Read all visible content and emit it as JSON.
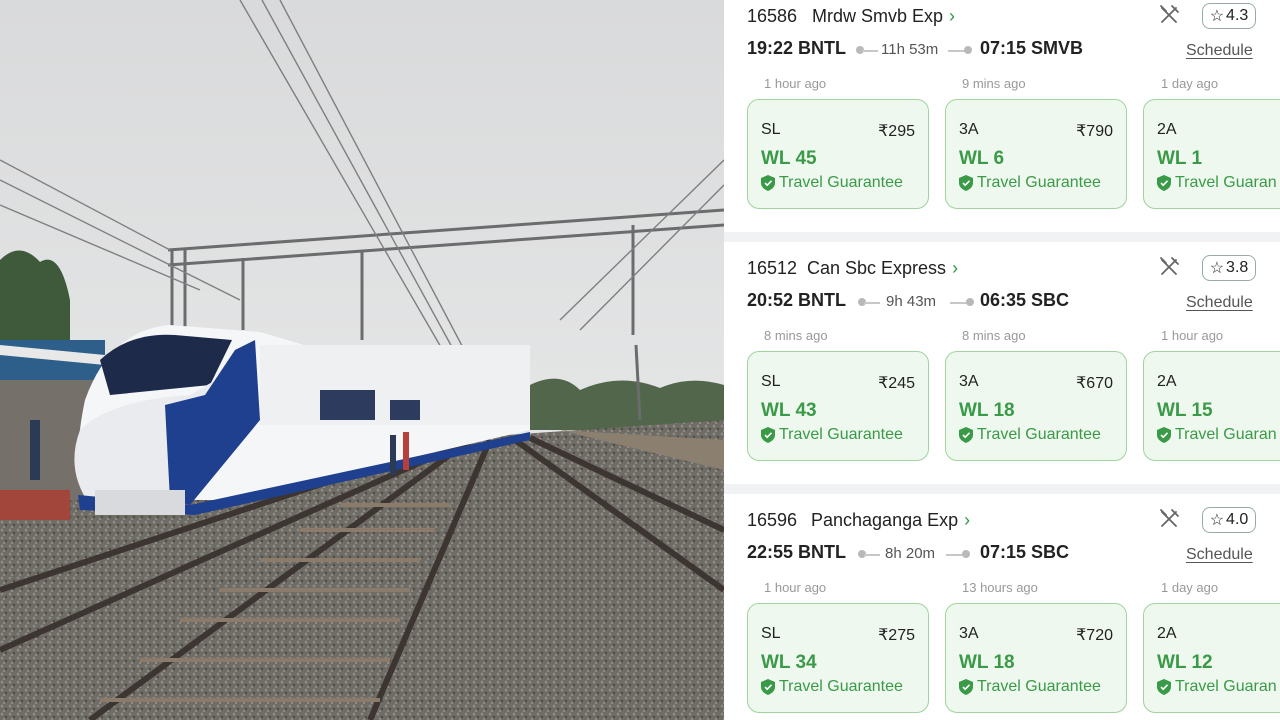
{
  "trains": [
    {
      "number": "16586",
      "name": "Mrdw Smvb Exp",
      "rating": "4.3",
      "departure": "19:22 BNTL",
      "duration": "11h 53m",
      "arrival": "07:15 SMVB",
      "schedule_label": "Schedule",
      "classes": [
        {
          "updated": "1 hour ago",
          "class": "SL",
          "fare": "₹295",
          "status": "WL 45",
          "guarantee": "Travel Guarantee"
        },
        {
          "updated": "9 mins ago",
          "class": "3A",
          "fare": "₹790",
          "status": "WL 6",
          "guarantee": "Travel Guarantee"
        },
        {
          "updated": "1 day ago",
          "class": "2A",
          "fare": "₹",
          "status": "WL 1",
          "guarantee": "Travel Guaran"
        }
      ]
    },
    {
      "number": "16512",
      "name": "Can Sbc Express",
      "rating": "3.8",
      "departure": "20:52 BNTL",
      "duration": "9h 43m",
      "arrival": "06:35 SBC",
      "schedule_label": "Schedule",
      "classes": [
        {
          "updated": "8 mins ago",
          "class": "SL",
          "fare": "₹245",
          "status": "WL 43",
          "guarantee": "Travel Guarantee"
        },
        {
          "updated": "8 mins ago",
          "class": "3A",
          "fare": "₹670",
          "status": "WL 18",
          "guarantee": "Travel Guarantee"
        },
        {
          "updated": "1 hour ago",
          "class": "2A",
          "fare": "₹",
          "status": "WL 15",
          "guarantee": "Travel Guaran"
        }
      ]
    },
    {
      "number": "16596",
      "name": "Panchaganga Exp",
      "rating": "4.0",
      "departure": "22:55 BNTL",
      "duration": "8h 20m",
      "arrival": "07:15 SBC",
      "schedule_label": "Schedule",
      "classes": [
        {
          "updated": "1 hour ago",
          "class": "SL",
          "fare": "₹275",
          "status": "WL 34",
          "guarantee": "Travel Guarantee"
        },
        {
          "updated": "13 hours ago",
          "class": "3A",
          "fare": "₹720",
          "status": "WL 18",
          "guarantee": "Travel Guarantee"
        },
        {
          "updated": "1 day ago",
          "class": "2A",
          "fare": "₹",
          "status": "WL 12",
          "guarantee": "Travel Guaran"
        }
      ]
    }
  ],
  "icons": {
    "pantry": "fork-knife-icon",
    "rating": "star-icon",
    "guarantee": "shield-check-icon",
    "chevron": "chevron-right-icon"
  },
  "colors": {
    "available_green": "#3a9a48",
    "card_bg": "#eff8ef",
    "card_border": "#9fd39f"
  }
}
